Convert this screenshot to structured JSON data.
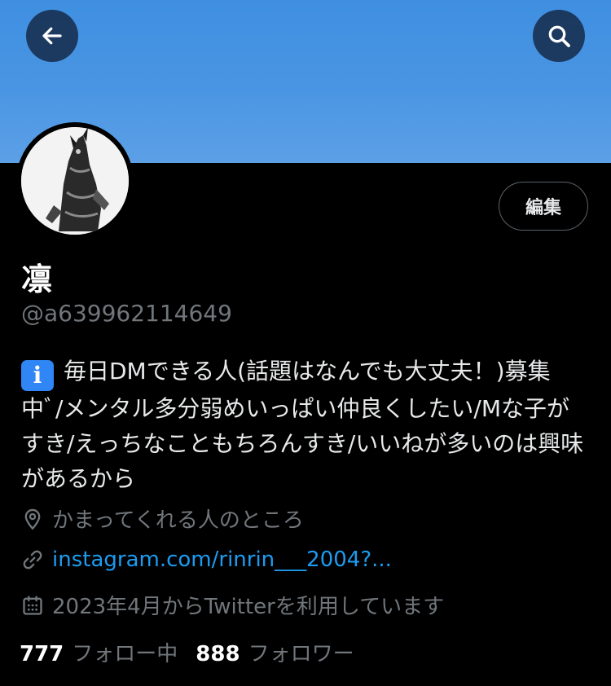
{
  "header": {
    "back_icon": "arrow-left-icon",
    "search_icon": "search-icon",
    "banner_color": "#4a95e3"
  },
  "profile": {
    "name": "凛",
    "handle": "@a639962114649",
    "edit_label": "編集",
    "bio_emoji": "i",
    "bio": "毎日DMできる人(話題はなんでも大丈夫！)募集中ﾞ/メンタル多分弱めいっぱい仲良くしたい/Mな子がすき/えっちなこともちろんすき/いいねが多いのは興味があるから",
    "location": "かまってくれる人のところ",
    "link": "instagram.com/rinrin___2004?...",
    "joined": "2023年4月からTwitterを利用しています"
  },
  "stats": {
    "following_count": "777",
    "following_label": "フォロー中",
    "followers_count": "888",
    "followers_label": "フォロワー"
  },
  "colors": {
    "background": "#000000",
    "text": "#e7e9ea",
    "muted": "#71767b",
    "link": "#1d9bf0"
  }
}
